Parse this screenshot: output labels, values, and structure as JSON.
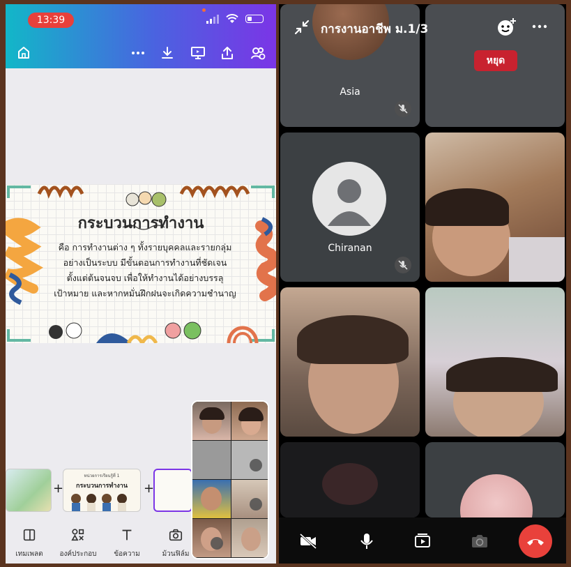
{
  "left_app": {
    "status_time": "13:39",
    "slide": {
      "title": "กระบวนการทำงาน",
      "body_lines": [
        "คือ การทำงานต่าง ๆ ทั้งรายบุคคลและรายกลุ่ม",
        "อย่างเป็นระบบ มีขั้นตอนการทำงานที่ชัดเจน",
        "ตั้งแต่ต้นจนจบ เพื่อให้ทำงานได้อย่างบรรลุ",
        "เป้าหมาย และหากหมั่นฝึกฝนจะเกิดความชำนาญ"
      ]
    },
    "thumbnail_2": {
      "header": "หน่วยการเรียนรู้ที่ 1",
      "title": "กระบวนการทำงาน"
    },
    "bottom_nav": [
      {
        "label": "เทมเพลต",
        "icon": "template-icon"
      },
      {
        "label": "องค์ประกอบ",
        "icon": "elements-icon"
      },
      {
        "label": "ข้อความ",
        "icon": "text-icon"
      },
      {
        "label": "ม้วนฟิล์ม",
        "icon": "camera-roll-icon"
      }
    ]
  },
  "right_app": {
    "meeting_title": "การงานอาชีพ ม.1/3",
    "stop_label": "หยุด",
    "participants": [
      {
        "name": "Asia",
        "muted": true
      },
      {
        "name": "",
        "muted": false
      },
      {
        "name": "Chiranan",
        "muted": true
      }
    ]
  }
}
